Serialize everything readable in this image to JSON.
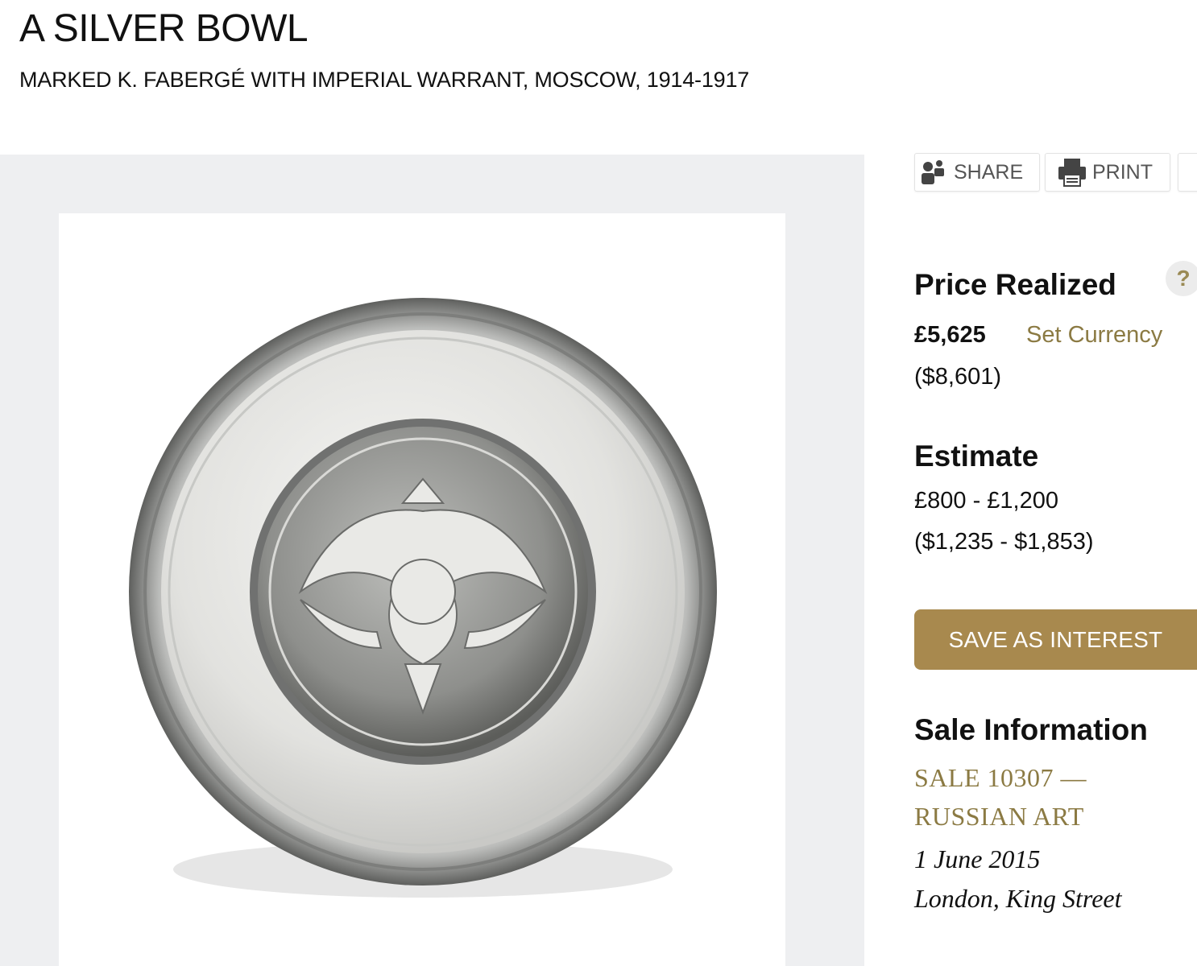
{
  "lot": {
    "title": "A SILVER BOWL",
    "subtitle": "MARKED K. FABERGÉ WITH IMPERIAL WARRANT, MOSCOW, 1914-1917"
  },
  "toolbar": {
    "share_label": "SHARE",
    "print_label": "PRINT"
  },
  "price": {
    "heading": "Price Realized",
    "help": "?",
    "gbp": "£5,625",
    "set_currency": "Set Currency",
    "usd": "($8,601)"
  },
  "estimate": {
    "heading": "Estimate",
    "gbp": "£800 - £1,200",
    "usd": "($1,235 - $1,853)"
  },
  "actions": {
    "save_interest": "SAVE AS INTEREST"
  },
  "sale": {
    "heading": "Sale Information",
    "line1": "SALE 10307 —",
    "line2": "RUSSIAN ART",
    "date": "1 June 2015",
    "location": "London, King Street"
  },
  "colors": {
    "accent_gold": "#a8894e",
    "link_gold": "#8b7a43",
    "panel_gray": "#eeeff1"
  },
  "icons": [
    "share-icon",
    "print-icon",
    "help-icon"
  ]
}
